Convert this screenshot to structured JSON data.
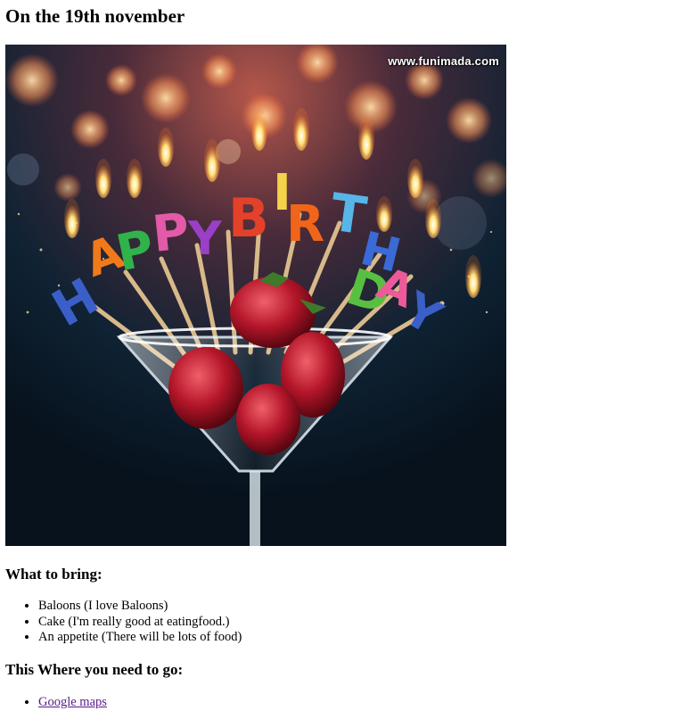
{
  "page": {
    "title": "On the 19th november"
  },
  "photo": {
    "watermark": "www.funimada.com",
    "candle_letters": [
      "H",
      "A",
      "P",
      "P",
      "Y",
      "B",
      "I",
      "R",
      "T",
      "H",
      "D",
      "A",
      "Y"
    ]
  },
  "bring": {
    "heading": "What to bring:",
    "items": [
      "Baloons (I love Baloons)",
      "Cake (I'm really good at eatingfood.)",
      "An appetite (There will be lots of food)"
    ]
  },
  "where": {
    "heading": "This Where you need to go:",
    "link_label": "Google maps"
  },
  "colors": {
    "link": "#551a8b",
    "text": "#000000",
    "background": "#ffffff"
  }
}
